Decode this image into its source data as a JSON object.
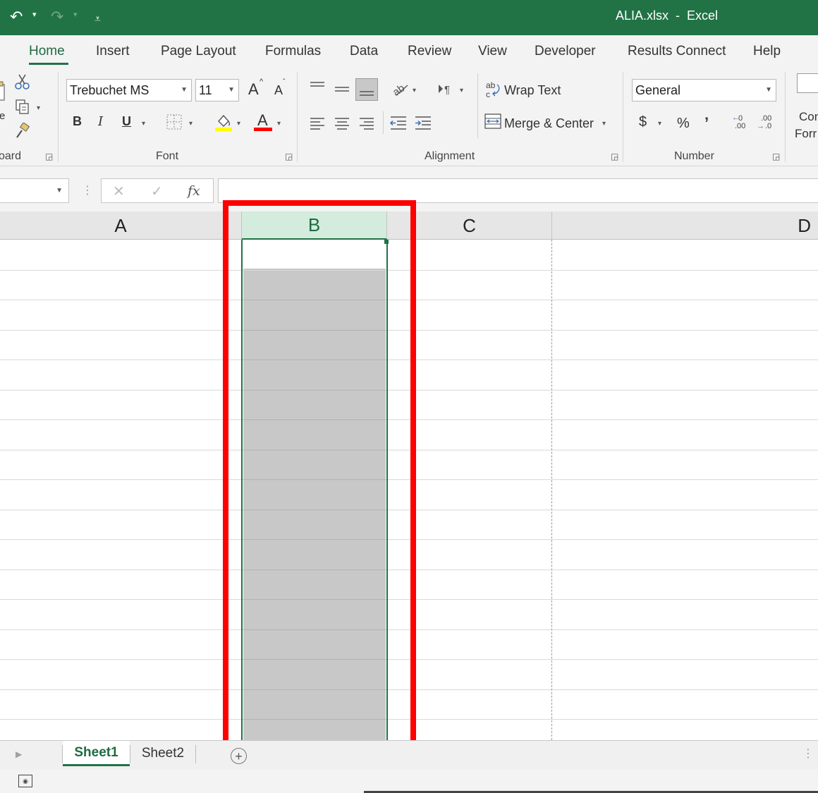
{
  "window": {
    "title": "ALIA.xlsx  -  Excel",
    "accent": "#217346"
  },
  "quick_access": {
    "undo_icon": "↶",
    "redo_icon": "↷",
    "dropdown_icon": "▾",
    "customize_icon": "⩡"
  },
  "tabs": [
    {
      "label": "Home"
    },
    {
      "label": "Insert"
    },
    {
      "label": "Page Layout"
    },
    {
      "label": "Formulas"
    },
    {
      "label": "Data"
    },
    {
      "label": "Review"
    },
    {
      "label": "View"
    },
    {
      "label": "Developer"
    },
    {
      "label": "Results Connect"
    },
    {
      "label": "Help"
    }
  ],
  "ribbon": {
    "clipboard": {
      "group_label": "oard",
      "paste_partial": "e"
    },
    "font": {
      "group_label": "Font",
      "font_name": "Trebuchet MS",
      "font_size": "11",
      "grow_label": "A",
      "shrink_label": "A",
      "bold_label": "B",
      "italic_label": "I",
      "underline_label": "U",
      "font_color_label": "A"
    },
    "alignment": {
      "group_label": "Alignment",
      "wrap_text": "Wrap Text",
      "merge_center": "Merge & Center"
    },
    "number": {
      "group_label": "Number",
      "format": "General",
      "currency_label": "$",
      "percent_label": "%",
      "comma_label": "’",
      "inc_decimal": ".00",
      "dec_decimal": ".00"
    },
    "styles": {
      "cond_format_line1": "Con",
      "cond_format_line2": "Forr"
    }
  },
  "formula_bar": {
    "cancel_icon": "✕",
    "enter_icon": "✓",
    "fx_label": "fx",
    "name_box": "",
    "value": ""
  },
  "grid": {
    "columns": [
      {
        "label": "A"
      },
      {
        "label": "B"
      },
      {
        "label": "C"
      },
      {
        "label": "D"
      }
    ],
    "selected_column": "B"
  },
  "sheets": [
    {
      "label": "Sheet1"
    },
    {
      "label": "Sheet2"
    }
  ],
  "sheet_bar": {
    "add_label": "+"
  }
}
